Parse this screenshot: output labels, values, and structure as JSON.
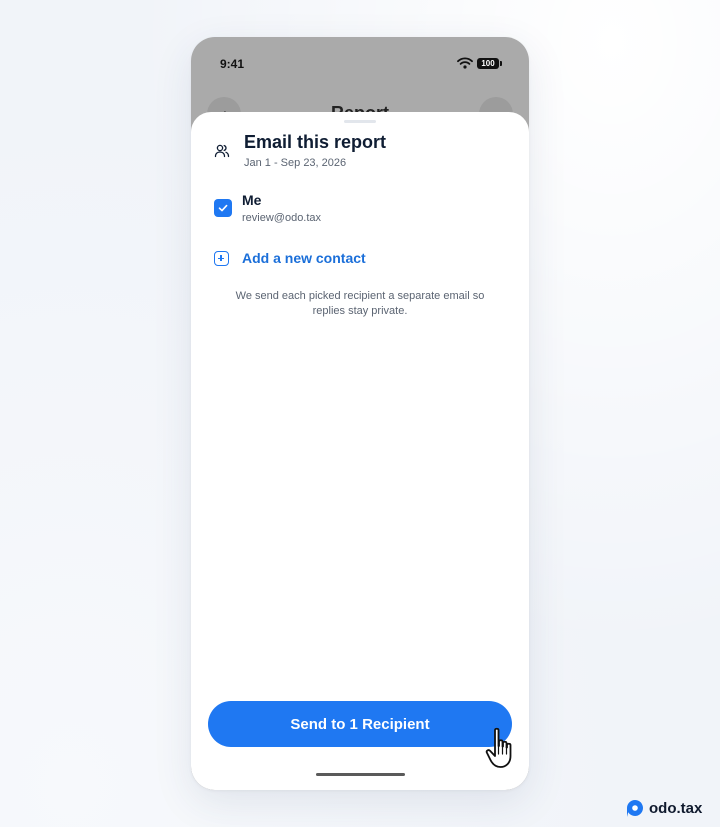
{
  "status_bar": {
    "time": "9:41",
    "battery": "100",
    "wifi_icon": "wifi-icon"
  },
  "background_screen": {
    "title": "Report",
    "back_icon": "chevron-left-icon"
  },
  "sheet": {
    "title": "Email this report",
    "date_range": "Jan 1 - Sep 23, 2026",
    "header_icon": "people-icon",
    "contacts": [
      {
        "name": "Me",
        "email": "review@odo.tax",
        "checked": true
      }
    ],
    "add_contact_label": "Add a new contact",
    "add_contact_icon": "plus-square-icon",
    "note": "We send each picked recipient a separate email so replies stay private.",
    "send_button_label": "Send to 1 Recipient"
  },
  "brand": {
    "name": "odo.tax"
  },
  "colors": {
    "accent": "#1f78f2",
    "text_primary": "#0f1d33",
    "text_secondary": "#5b6472",
    "link": "#1b6fd9"
  }
}
